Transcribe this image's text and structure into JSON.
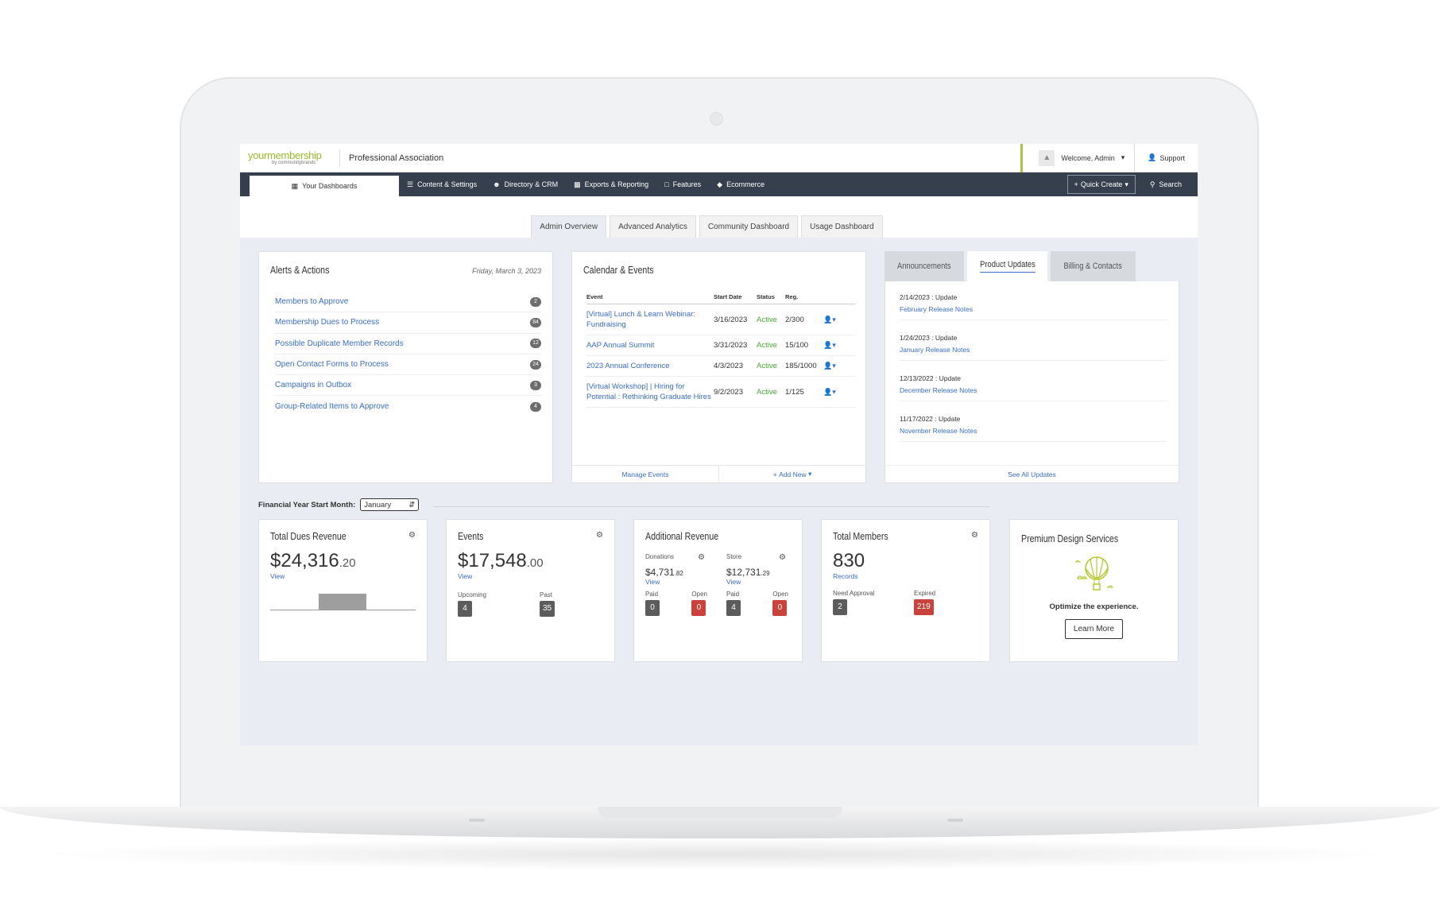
{
  "brand": {
    "logo_main": "yourmembership",
    "logo_sub": "by communitybrands"
  },
  "header": {
    "org_name": "Professional Association",
    "welcome": "Welcome, Admin",
    "support": "Support"
  },
  "nav": {
    "items": [
      "Your Dashboards",
      "Content & Settings",
      "Directory & CRM",
      "Exports & Reporting",
      "Features",
      "Ecommerce"
    ],
    "quick_create": "Quick Create",
    "search": "Search"
  },
  "subtabs": [
    "Admin Overview",
    "Advanced Analytics",
    "Community Dashboard",
    "Usage Dashboard"
  ],
  "alerts": {
    "title": "Alerts & Actions",
    "date": "Friday, March 3, 2023",
    "items": [
      {
        "label": "Members to Approve",
        "count": "2"
      },
      {
        "label": "Membership Dues to Process",
        "count": "84"
      },
      {
        "label": "Possible Duplicate Member Records",
        "count": "12"
      },
      {
        "label": "Open Contact Forms to Process",
        "count": "24"
      },
      {
        "label": "Campaigns in Outbox",
        "count": "3"
      },
      {
        "label": "Group-Related Items to Approve",
        "count": "4"
      }
    ]
  },
  "calendar": {
    "title": "Calendar & Events",
    "columns": [
      "Event",
      "Start Date",
      "Status",
      "Reg."
    ],
    "rows": [
      {
        "event": "[Virtual] Lunch & Learn Webinar: Fundraising",
        "start": "3/16/2023",
        "status": "Active",
        "reg": "2/300"
      },
      {
        "event": "AAP Annual Summit",
        "start": "3/31/2023",
        "status": "Active",
        "reg": "15/100"
      },
      {
        "event": "2023 Annual Conference",
        "start": "4/3/2023",
        "status": "Active",
        "reg": "185/1000"
      },
      {
        "event": "[Virtual Workshop] | Hiring for Potential : Rethinking Graduate Hires",
        "start": "9/2/2023",
        "status": "Active",
        "reg": "1/125"
      }
    ],
    "manage": "Manage Events",
    "add_new": "Add New"
  },
  "updates": {
    "tabs": [
      "Announcements",
      "Product Updates",
      "Billing & Contacts"
    ],
    "items": [
      {
        "date": "2/14/2023 : Update",
        "link": "February Release Notes"
      },
      {
        "date": "1/24/2023 : Update",
        "link": "January Release Notes"
      },
      {
        "date": "12/13/2022 : Update",
        "link": "December Release Notes"
      },
      {
        "date": "11/17/2022 : Update",
        "link": "November Release Notes"
      }
    ],
    "see_all": "See All Updates"
  },
  "financial_year": {
    "label": "Financial Year Start Month:",
    "value": "January"
  },
  "stats": {
    "dues": {
      "title": "Total Dues Revenue",
      "amount": "$24,316",
      "cents": ".20",
      "view": "View",
      "bar_fraction": 0.85
    },
    "events": {
      "title": "Events",
      "amount": "$17,548",
      "cents": ".00",
      "view": "View",
      "upcoming_label": "Upcoming",
      "upcoming": "4",
      "past_label": "Past",
      "past": "35"
    },
    "additional": {
      "title": "Additional Revenue",
      "donations": {
        "label": "Donations",
        "amount": "$4,731",
        "cents": ".82",
        "view": "View",
        "paid_label": "Paid",
        "paid": "0",
        "open_label": "Open",
        "open": "0"
      },
      "store": {
        "label": "Store",
        "amount": "$12,731",
        "cents": ".29",
        "view": "View",
        "paid_label": "Paid",
        "paid": "4",
        "open_label": "Open",
        "open": "0"
      }
    },
    "members": {
      "title": "Total Members",
      "count": "830",
      "records": "Records",
      "need_label": "Need Approval",
      "need": "2",
      "expired_label": "Expired",
      "expired": "219"
    }
  },
  "premium": {
    "title": "Premium Design Services",
    "tagline": "Optimize the experience.",
    "button": "Learn More"
  },
  "colors": {
    "nav_bg": "#353f4d",
    "link": "#3a6dc7",
    "active_green": "#4aa83a",
    "accent": "#9aba2c",
    "red_badge": "#c9423b"
  }
}
